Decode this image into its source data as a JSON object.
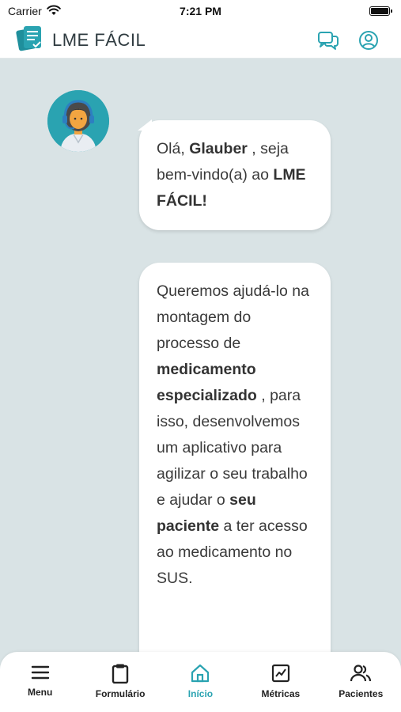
{
  "status_bar": {
    "carrier": "Carrier",
    "time": "7:21 PM"
  },
  "header": {
    "app_title": "LME FÁCIL",
    "icons": [
      "logo-icon",
      "chat-bubbles-icon",
      "profile-icon"
    ]
  },
  "chat": {
    "greeting": {
      "prefix": "Olá, ",
      "user_name": "Glauber",
      "middle": " , seja bem-vindo(a) ao ",
      "app_name": "LME FÁCIL!"
    },
    "intro": {
      "part1": "Queremos ajudá-lo na montagem do processo de ",
      "highlight1": "medicamento especializado",
      "part2": " , para isso, desenvolvemos um aplicativo para agilizar o seu trabalho e ajudar o ",
      "highlight2": "seu paciente",
      "part3": " a ter acesso ao medicamento no SUS."
    }
  },
  "bottom_nav": {
    "items": [
      {
        "label": "Menu",
        "icon": "menu-icon"
      },
      {
        "label": "Formulário",
        "icon": "clipboard-icon"
      },
      {
        "label": "Início",
        "icon": "home-icon",
        "active": true
      },
      {
        "label": "Métricas",
        "icon": "chart-icon"
      },
      {
        "label": "Pacientes",
        "icon": "users-icon"
      }
    ]
  },
  "colors": {
    "accent": "#2aa3b1",
    "background": "#d9e3e5",
    "text": "#3a3a3a"
  }
}
